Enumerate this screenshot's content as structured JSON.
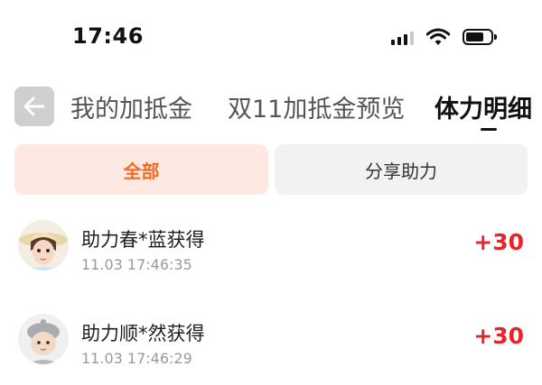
{
  "status_bar": {
    "time": "17:46"
  },
  "nav": {
    "tabs": [
      {
        "label": "我的加抵金"
      },
      {
        "label": "双11加抵金预览"
      },
      {
        "label": "体力明细",
        "active": true
      }
    ]
  },
  "filters": [
    {
      "label": "全部",
      "selected": true
    },
    {
      "label": "分享助力",
      "selected": false
    }
  ],
  "records": [
    {
      "name": "助力春*蓝获得",
      "datetime": "11.03 17:46:35",
      "points": "+30"
    },
    {
      "name": "助力顺*然获得",
      "datetime": "11.03 17:46:29",
      "points": "+30"
    }
  ],
  "colors": {
    "accent": "#f26a22",
    "points": "#e5252b",
    "filter_selected_bg": "#fde9e1"
  },
  "icons": [
    "back-arrow-icon",
    "cellular-signal-icon",
    "wifi-icon",
    "battery-icon"
  ]
}
